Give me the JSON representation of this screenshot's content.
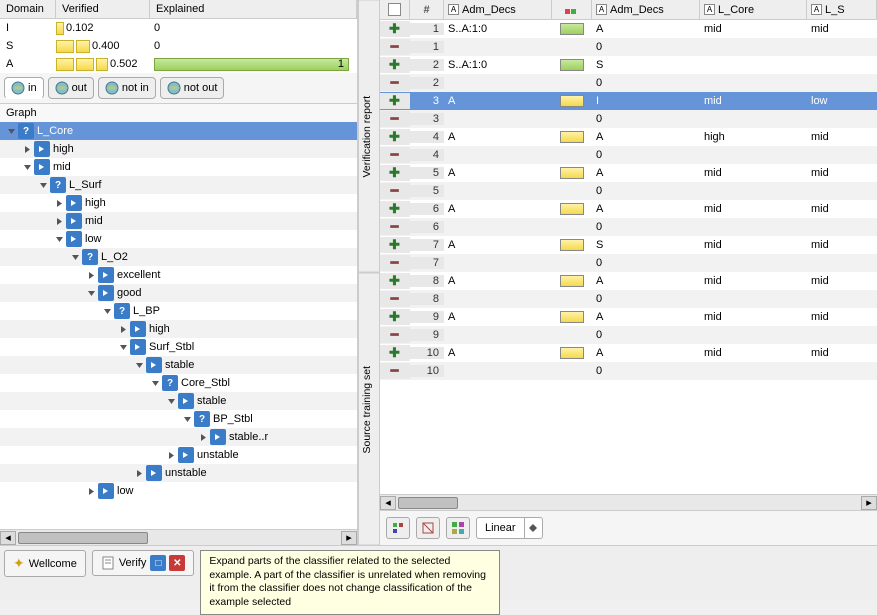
{
  "domain_table": {
    "headers": {
      "domain": "Domain",
      "verified": "Verified",
      "explained": "Explained"
    },
    "rows": [
      {
        "label": "I",
        "verified": "0.102",
        "bar1w": 8,
        "bar2w": 0,
        "explained": "0",
        "greenbar": false
      },
      {
        "label": "S",
        "verified": "0.400",
        "bar1w": 18,
        "bar2w": 14,
        "explained": "0",
        "greenbar": false
      },
      {
        "label": "A",
        "verified": "0.502",
        "bar1w": 18,
        "bar2w": 18,
        "bar3w": 12,
        "explained": "1",
        "greenbar": true
      }
    ]
  },
  "tabs": [
    {
      "label": "in",
      "active": true
    },
    {
      "label": "out",
      "active": false
    },
    {
      "label": "not in",
      "active": false
    },
    {
      "label": "not out",
      "active": false
    }
  ],
  "graph_label": "Graph",
  "tree": [
    {
      "depth": 0,
      "expand": "down",
      "icon": "q",
      "label": "L_Core",
      "selected": true
    },
    {
      "depth": 1,
      "expand": "right",
      "icon": "arrow",
      "label": "high"
    },
    {
      "depth": 1,
      "expand": "down",
      "icon": "arrow",
      "label": "mid"
    },
    {
      "depth": 2,
      "expand": "down",
      "icon": "q",
      "label": "L_Surf"
    },
    {
      "depth": 3,
      "expand": "right",
      "icon": "arrow",
      "label": "high"
    },
    {
      "depth": 3,
      "expand": "right",
      "icon": "arrow",
      "label": "mid"
    },
    {
      "depth": 3,
      "expand": "down",
      "icon": "arrow",
      "label": "low"
    },
    {
      "depth": 4,
      "expand": "down",
      "icon": "q",
      "label": "L_O2"
    },
    {
      "depth": 5,
      "expand": "right",
      "icon": "arrow",
      "label": "excellent"
    },
    {
      "depth": 5,
      "expand": "down",
      "icon": "arrow",
      "label": "good"
    },
    {
      "depth": 6,
      "expand": "down",
      "icon": "q",
      "label": "L_BP"
    },
    {
      "depth": 7,
      "expand": "right",
      "icon": "arrow",
      "label": "high"
    },
    {
      "depth": 7,
      "expand": "down",
      "icon": "arrow",
      "label": "Surf_Stbl"
    },
    {
      "depth": 8,
      "expand": "down",
      "icon": "arrow",
      "label": "stable"
    },
    {
      "depth": 9,
      "expand": "down",
      "icon": "q",
      "label": "Core_Stbl"
    },
    {
      "depth": 10,
      "expand": "down",
      "icon": "arrow",
      "label": "stable"
    },
    {
      "depth": 11,
      "expand": "down",
      "icon": "q",
      "label": "BP_Stbl"
    },
    {
      "depth": 12,
      "expand": "right",
      "icon": "arrow",
      "label": "stable..r"
    },
    {
      "depth": 10,
      "expand": "right",
      "icon": "arrow",
      "label": "unstable"
    },
    {
      "depth": 8,
      "expand": "right",
      "icon": "arrow",
      "label": "unstable"
    },
    {
      "depth": 5,
      "expand": "right",
      "icon": "arrow",
      "label": "low"
    }
  ],
  "vert_tabs": [
    {
      "label": "Verification report"
    },
    {
      "label": "Source training set"
    }
  ],
  "grid": {
    "headers": {
      "adm1": "Adm_Decs",
      "adm2": "Adm_Decs",
      "lcore": "L_Core",
      "lsurf": "L_S"
    },
    "rows": [
      {
        "type": "plus",
        "n": "1",
        "adm1": "S..A:1:0",
        "swatch": "green",
        "adm2": "A",
        "lcore": "mid",
        "lsurf": "mid"
      },
      {
        "type": "minus",
        "n": "1",
        "adm1": "",
        "swatch": "",
        "adm2": "0",
        "lcore": "",
        "lsurf": ""
      },
      {
        "type": "plus",
        "n": "2",
        "adm1": "S..A:1:0",
        "swatch": "green",
        "adm2": "S",
        "lcore": "",
        "lsurf": ""
      },
      {
        "type": "minus",
        "n": "2",
        "adm1": "",
        "swatch": "",
        "adm2": "0",
        "lcore": "",
        "lsurf": ""
      },
      {
        "type": "plus",
        "n": "3",
        "adm1": "A",
        "swatch": "yellow",
        "adm2": "I",
        "lcore": "mid",
        "lsurf": "low",
        "selected": true
      },
      {
        "type": "minus",
        "n": "3",
        "adm1": "",
        "swatch": "",
        "adm2": "0",
        "lcore": "",
        "lsurf": ""
      },
      {
        "type": "plus",
        "n": "4",
        "adm1": "A",
        "swatch": "yellow",
        "adm2": "A",
        "lcore": "high",
        "lsurf": "mid"
      },
      {
        "type": "minus",
        "n": "4",
        "adm1": "",
        "swatch": "",
        "adm2": "0",
        "lcore": "",
        "lsurf": ""
      },
      {
        "type": "plus",
        "n": "5",
        "adm1": "A",
        "swatch": "yellow",
        "adm2": "A",
        "lcore": "mid",
        "lsurf": "mid"
      },
      {
        "type": "minus",
        "n": "5",
        "adm1": "",
        "swatch": "",
        "adm2": "0",
        "lcore": "",
        "lsurf": ""
      },
      {
        "type": "plus",
        "n": "6",
        "adm1": "A",
        "swatch": "yellow",
        "adm2": "A",
        "lcore": "mid",
        "lsurf": "mid"
      },
      {
        "type": "minus",
        "n": "6",
        "adm1": "",
        "swatch": "",
        "adm2": "0",
        "lcore": "",
        "lsurf": ""
      },
      {
        "type": "plus",
        "n": "7",
        "adm1": "A",
        "swatch": "yellow",
        "adm2": "S",
        "lcore": "mid",
        "lsurf": "mid"
      },
      {
        "type": "minus",
        "n": "7",
        "adm1": "",
        "swatch": "",
        "adm2": "0",
        "lcore": "",
        "lsurf": ""
      },
      {
        "type": "plus",
        "n": "8",
        "adm1": "A",
        "swatch": "yellow",
        "adm2": "A",
        "lcore": "mid",
        "lsurf": "mid"
      },
      {
        "type": "minus",
        "n": "8",
        "adm1": "",
        "swatch": "",
        "adm2": "0",
        "lcore": "",
        "lsurf": ""
      },
      {
        "type": "plus",
        "n": "9",
        "adm1": "A",
        "swatch": "yellow",
        "adm2": "A",
        "lcore": "mid",
        "lsurf": "mid"
      },
      {
        "type": "minus",
        "n": "9",
        "adm1": "",
        "swatch": "",
        "adm2": "0",
        "lcore": "",
        "lsurf": ""
      },
      {
        "type": "plus",
        "n": "10",
        "adm1": "A",
        "swatch": "yellow",
        "adm2": "A",
        "lcore": "mid",
        "lsurf": "mid"
      },
      {
        "type": "minus",
        "n": "10",
        "adm1": "",
        "swatch": "",
        "adm2": "0",
        "lcore": "",
        "lsurf": ""
      }
    ]
  },
  "toolbar": {
    "select_label": "Linear"
  },
  "footer": {
    "wellcome": "Wellcome",
    "verify": "Verify",
    "tooltip": "Expand parts of the classifier related to the selected example. A part of the classifier is unrelated when removing it from the classifier does not change classification of the example selected"
  }
}
